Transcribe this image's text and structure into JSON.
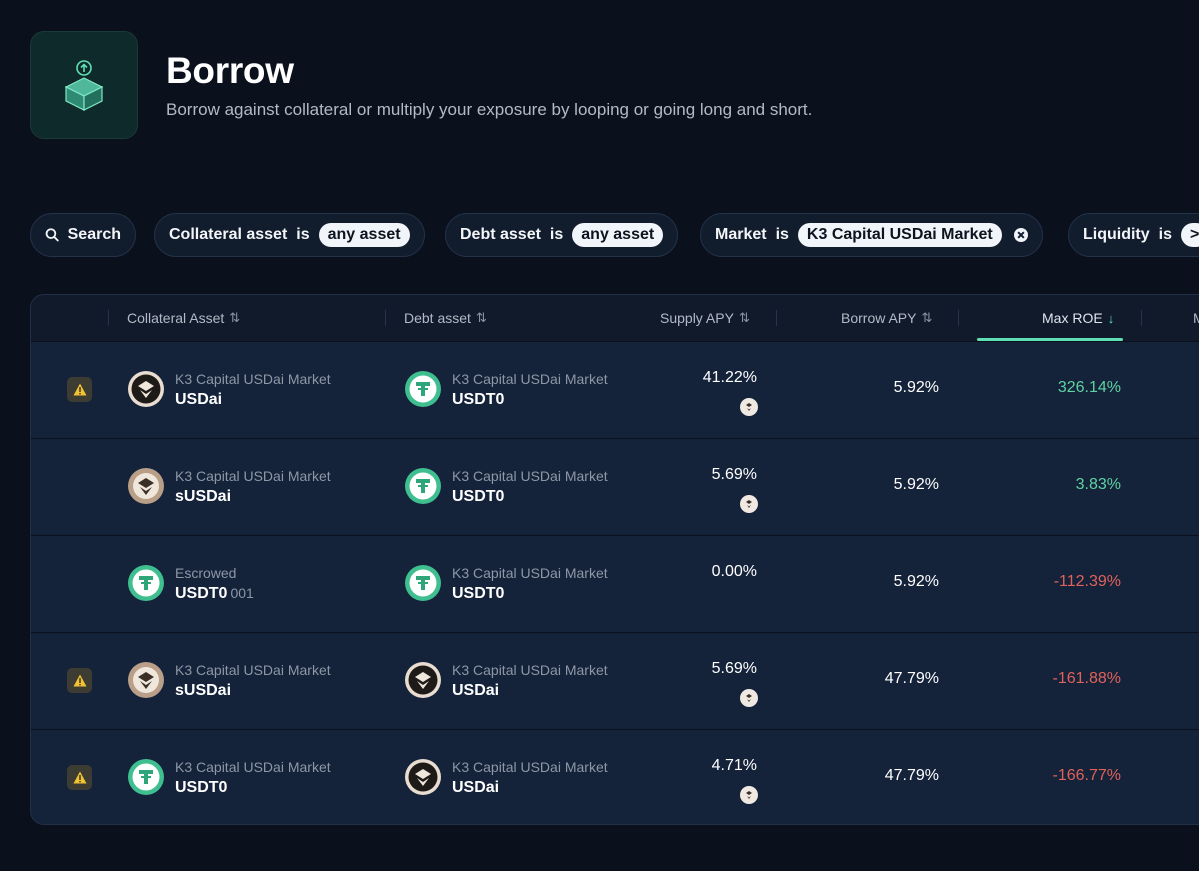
{
  "header": {
    "title": "Borrow",
    "subtitle": "Borrow against collateral or multiply your exposure by looping or going long and short."
  },
  "filters": {
    "search_label": "Search",
    "collateral": {
      "label": "Collateral asset",
      "op": "is",
      "value": "any asset"
    },
    "debt": {
      "label": "Debt asset",
      "op": "is",
      "value": "any asset"
    },
    "market": {
      "label": "Market",
      "op": "is",
      "value": "K3 Capital USDai Market"
    },
    "liquidity": {
      "label": "Liquidity",
      "op": "is",
      "value": ">"
    }
  },
  "table": {
    "columns": {
      "collateral": "Collateral Asset",
      "debt": "Debt asset",
      "supply_apy": "Supply APY",
      "borrow_apy": "Borrow APY",
      "max_roe": "Max ROE",
      "next": "M"
    },
    "rows": [
      {
        "warning": true,
        "collateral": {
          "market": "K3 Capital USDai Market",
          "symbol": "USDai",
          "suffix": "",
          "icon": "usdai-icon"
        },
        "debt": {
          "market": "K3 Capital USDai Market",
          "symbol": "USDT0",
          "icon": "usdt0-icon"
        },
        "supply_apy": "41.22%",
        "borrow_apy": "5.92%",
        "max_roe": "326.14%",
        "roe_sign": "pos"
      },
      {
        "warning": false,
        "collateral": {
          "market": "K3 Capital USDai Market",
          "symbol": "sUSDai",
          "suffix": "",
          "icon": "susdai-icon"
        },
        "debt": {
          "market": "K3 Capital USDai Market",
          "symbol": "USDT0",
          "icon": "usdt0-icon"
        },
        "supply_apy": "5.69%",
        "borrow_apy": "5.92%",
        "max_roe": "3.83%",
        "roe_sign": "pos"
      },
      {
        "warning": false,
        "collateral": {
          "market": "Escrowed",
          "symbol": "USDT0",
          "suffix": "001",
          "icon": "usdt0-icon"
        },
        "debt": {
          "market": "K3 Capital USDai Market",
          "symbol": "USDT0",
          "icon": "usdt0-icon"
        },
        "supply_apy": "0.00%",
        "borrow_apy": "5.92%",
        "max_roe": "-112.39%",
        "roe_sign": "neg"
      },
      {
        "warning": true,
        "collateral": {
          "market": "K3 Capital USDai Market",
          "symbol": "sUSDai",
          "suffix": "",
          "icon": "susdai-icon"
        },
        "debt": {
          "market": "K3 Capital USDai Market",
          "symbol": "USDai",
          "icon": "usdai-icon"
        },
        "supply_apy": "5.69%",
        "borrow_apy": "47.79%",
        "max_roe": "-161.88%",
        "roe_sign": "neg"
      },
      {
        "warning": true,
        "collateral": {
          "market": "K3 Capital USDai Market",
          "symbol": "USDT0",
          "suffix": "",
          "icon": "usdt0-icon"
        },
        "debt": {
          "market": "K3 Capital USDai Market",
          "symbol": "USDai",
          "icon": "usdai-icon"
        },
        "supply_apy": "4.71%",
        "borrow_apy": "47.79%",
        "max_roe": "-166.77%",
        "roe_sign": "neg"
      }
    ]
  }
}
